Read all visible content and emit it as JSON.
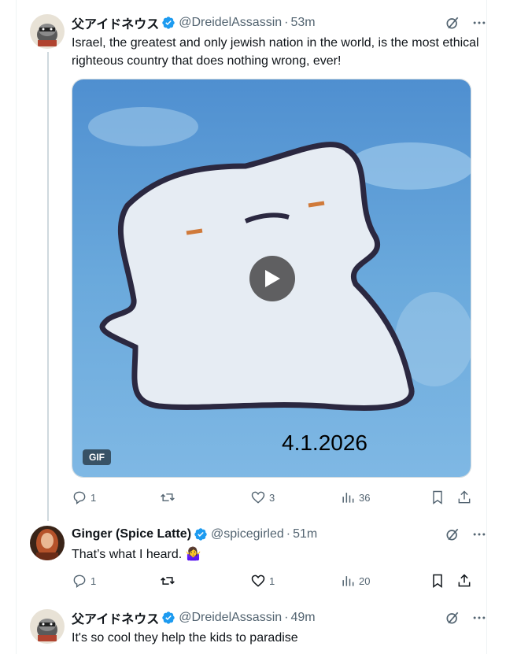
{
  "tweets": [
    {
      "name": "父アイドネウス",
      "handle": "@DreidelAssassin",
      "dot": "·",
      "time": "53m",
      "text": "Israel, the greatest and only jewish nation in the world,  is the most ethical righteous country that does nothing wrong, ever!",
      "media": {
        "badge": "GIF",
        "overlay_text": "4.1.2026"
      },
      "replies": "1",
      "likes": "3",
      "views": "36"
    },
    {
      "name": "Ginger (Spice Latte)",
      "handle": "@spicegirled",
      "dot": "·",
      "time": "51m",
      "text": "That’s what I heard. 🤷‍♀️",
      "replies": "1",
      "likes": "1",
      "views": "20"
    },
    {
      "name": "父アイドネウス",
      "handle": "@DreidelAssassin",
      "dot": "·",
      "time": "49m",
      "text": "It's so cool they help the kids to paradise"
    }
  ],
  "colors": {
    "verified": "#1d9bf0",
    "text": "#0f1419",
    "muted": "#536471",
    "border": "#cfd9de"
  },
  "icons": [
    "grok-icon",
    "more-icon",
    "reply-icon",
    "retweet-icon",
    "like-icon",
    "views-icon",
    "bookmark-icon",
    "share-icon",
    "play-icon",
    "verified-badge-icon"
  ]
}
